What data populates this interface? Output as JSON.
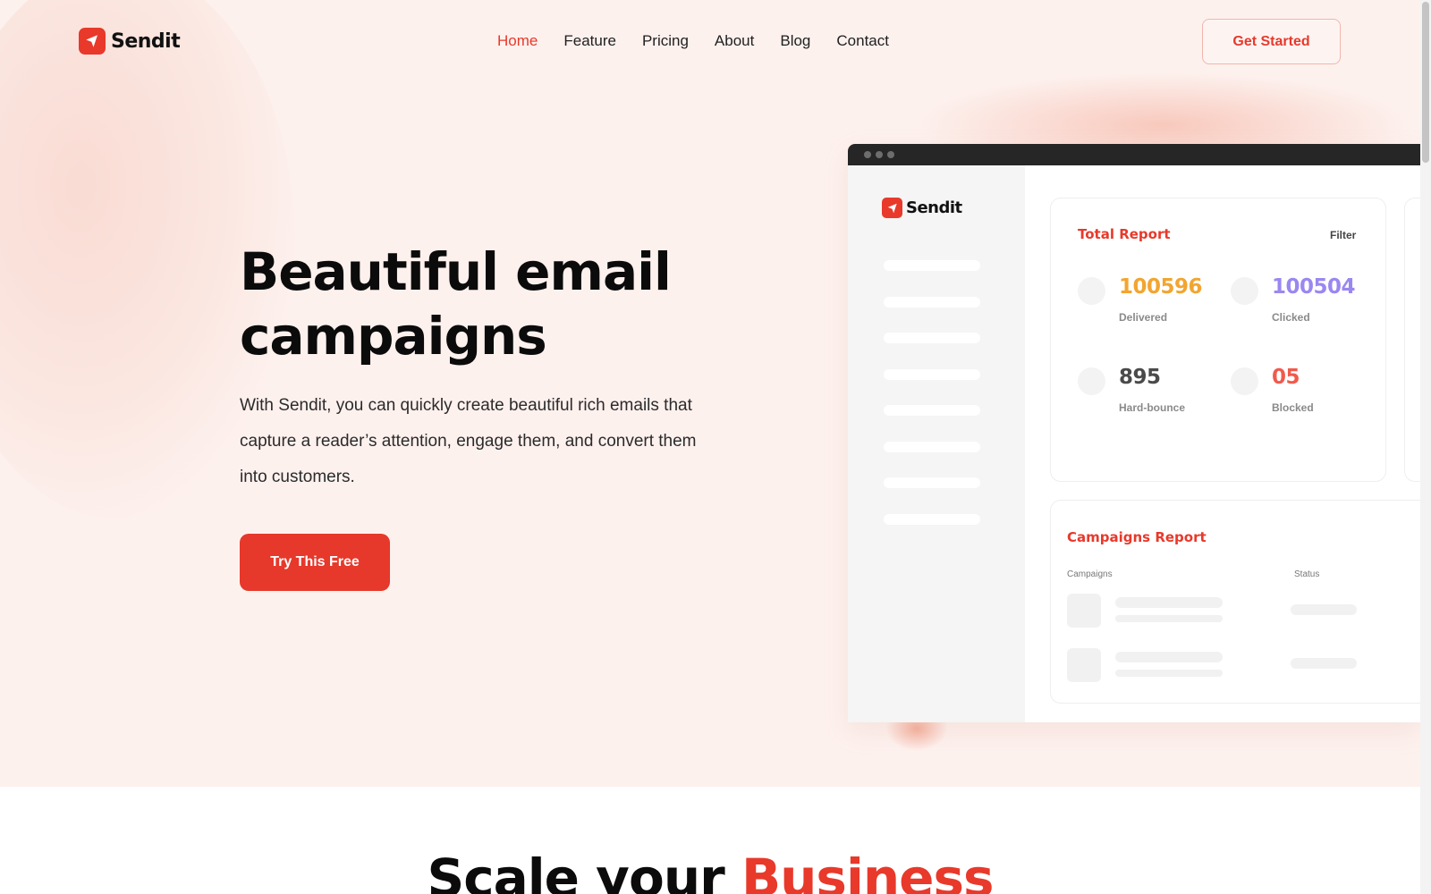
{
  "brand": {
    "name": "Sendit",
    "accent": "#e8392b"
  },
  "nav": {
    "items": [
      {
        "label": "Home",
        "active": true
      },
      {
        "label": "Feature"
      },
      {
        "label": "Pricing"
      },
      {
        "label": "About"
      },
      {
        "label": "Blog"
      },
      {
        "label": "Contact"
      }
    ],
    "cta_label": "Get Started"
  },
  "hero": {
    "headline": "Beautiful email campaigns",
    "subtext": "With Sendit, you can quickly create beautiful rich emails that capture a reader’s attention, engage them, and convert them into customers.",
    "button_label": "Try This Free"
  },
  "dashboard": {
    "logo": "Sendit",
    "total_report": {
      "title": "Total Report",
      "filter_label": "Filter",
      "stats": [
        {
          "value": "100596",
          "label": "Delivered",
          "color": "#f2a530"
        },
        {
          "value": "100504",
          "label": "Clicked",
          "color": "#9b87f0"
        },
        {
          "value": "895",
          "label": "Hard-bounce",
          "color": "#4a4a4a"
        },
        {
          "value": "05",
          "label": "Blocked",
          "color": "#f05a4b"
        }
      ]
    },
    "campaigns_report": {
      "title": "Campaigns Report",
      "col_campaigns": "Campaigns",
      "col_status": "Status"
    }
  },
  "section": {
    "title_main": "Scale your ",
    "title_accent": "Business"
  }
}
